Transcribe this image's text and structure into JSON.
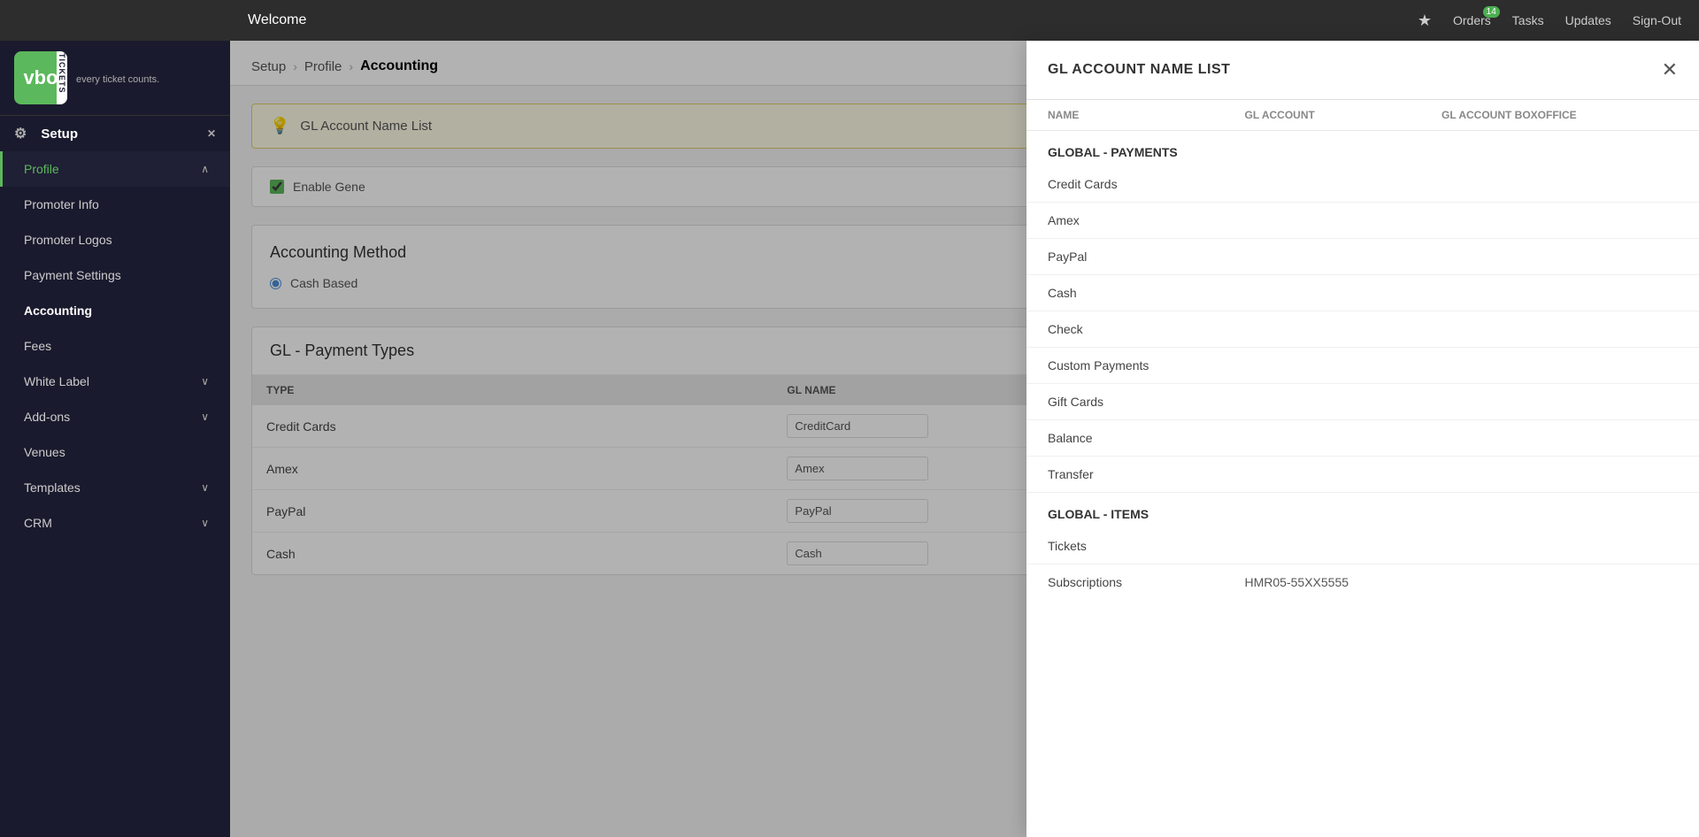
{
  "app": {
    "title": "VBO Tickets",
    "subtitle": "every ticket counts.",
    "welcome": "Welcome"
  },
  "topnav": {
    "star_label": "★",
    "orders_label": "Orders",
    "orders_badge": "14",
    "tasks_label": "Tasks",
    "updates_label": "Updates",
    "signout_label": "Sign-Out"
  },
  "sidebar": {
    "section_label": "Setup",
    "close_icon": "✕",
    "gear_icon": "⚙",
    "items": [
      {
        "label": "Profile",
        "active": true,
        "chevron": true
      },
      {
        "label": "Promoter Info",
        "active": false
      },
      {
        "label": "Promoter Logos",
        "active": false
      },
      {
        "label": "Payment Settings",
        "active": false
      },
      {
        "label": "Accounting",
        "active": false,
        "highlighted": true
      },
      {
        "label": "Fees",
        "active": false
      },
      {
        "label": "White Label",
        "active": false,
        "chevron": true
      },
      {
        "label": "Add-ons",
        "active": false,
        "chevron": true
      },
      {
        "label": "Venues",
        "active": false
      },
      {
        "label": "Templates",
        "active": false,
        "chevron": true
      },
      {
        "label": "CRM",
        "active": false,
        "chevron": true
      }
    ]
  },
  "breadcrumb": {
    "items": [
      "Setup",
      "Profile",
      "Accounting"
    ]
  },
  "gl_banner": {
    "icon": "💡",
    "text": "GL Account Name List"
  },
  "enable_section": {
    "label": "Enable Gene",
    "checked": true
  },
  "accounting_method": {
    "title": "Accounting Method",
    "option": "Cash Based",
    "selected": true
  },
  "gl_payment_types": {
    "title": "GL - Payment Types",
    "columns": [
      "TYPE",
      "GL NAME"
    ],
    "rows": [
      {
        "type": "Credit Cards",
        "gl_name": "CreditCard"
      },
      {
        "type": "Amex",
        "gl_name": "Amex"
      },
      {
        "type": "PayPal",
        "gl_name": "PayPal"
      },
      {
        "type": "Cash",
        "gl_name": "Cash"
      }
    ]
  },
  "side_panel": {
    "title": "GL ACCOUNT NAME LIST",
    "columns": [
      "NAME",
      "GL ACCOUNT",
      "GL ACCOUNT BOXOFFICE"
    ],
    "close_icon": "✕",
    "groups": [
      {
        "header": "GLOBAL - PAYMENTS",
        "items": [
          {
            "name": "Credit Cards",
            "gl_account": "",
            "gl_account_boxoffice": ""
          },
          {
            "name": "Amex",
            "gl_account": "",
            "gl_account_boxoffice": ""
          },
          {
            "name": "PayPal",
            "gl_account": "",
            "gl_account_boxoffice": ""
          },
          {
            "name": "Cash",
            "gl_account": "",
            "gl_account_boxoffice": ""
          },
          {
            "name": "Check",
            "gl_account": "",
            "gl_account_boxoffice": ""
          },
          {
            "name": "Custom Payments",
            "gl_account": "",
            "gl_account_boxoffice": ""
          },
          {
            "name": "Gift Cards",
            "gl_account": "",
            "gl_account_boxoffice": ""
          },
          {
            "name": "Balance",
            "gl_account": "",
            "gl_account_boxoffice": ""
          },
          {
            "name": "Transfer",
            "gl_account": "",
            "gl_account_boxoffice": ""
          }
        ]
      },
      {
        "header": "GLOBAL - ITEMS",
        "items": [
          {
            "name": "Tickets",
            "gl_account": "",
            "gl_account_boxoffice": ""
          },
          {
            "name": "Subscriptions",
            "gl_account": "HMR05-55XX5555",
            "gl_account_boxoffice": ""
          }
        ]
      }
    ]
  }
}
